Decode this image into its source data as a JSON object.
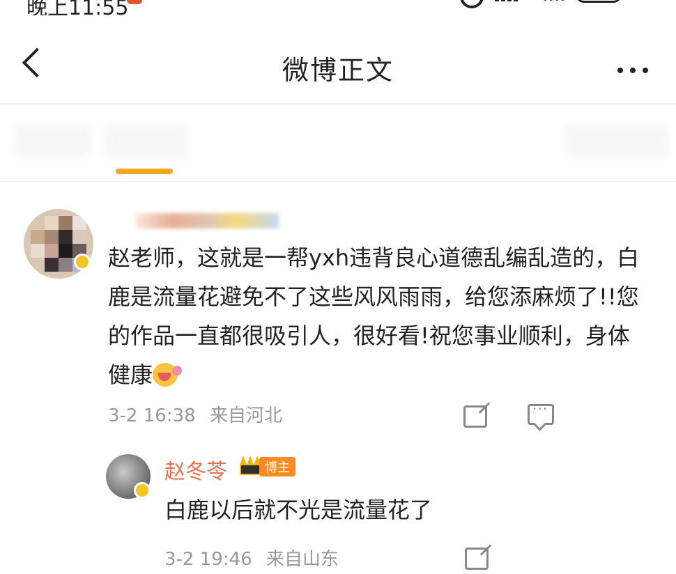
{
  "status_bar": {
    "time": "晚上11:55"
  },
  "nav": {
    "title": "微博正文",
    "back_icon": "chevron-left-icon",
    "more_icon": "ellipsis-icon"
  },
  "tabs": {
    "accent": "#f5a623"
  },
  "comment": {
    "text": "赵老师，这就是一帮yxh违背良心道德乱编乱造的，白鹿是流量花避免不了这些风风雨雨，给您添麻烦了!!您的作品一直都很吸引人，很好看!祝您事业顺利，身体健康",
    "date": "3-2 16:38",
    "location": "来自河北"
  },
  "reply": {
    "author": "赵冬苓",
    "badge": "博主",
    "text": "白鹿以后就不光是流量花了",
    "date": "3-2 19:46",
    "location": "来自山东",
    "name_color": "#eb7350"
  }
}
